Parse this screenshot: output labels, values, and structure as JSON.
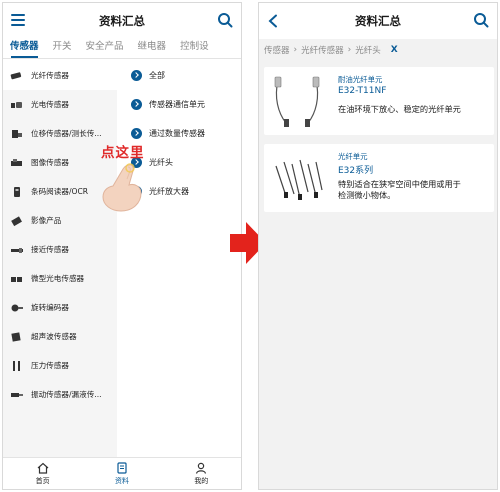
{
  "left_screen": {
    "header": {
      "title": "资料汇总"
    },
    "category_tabs": [
      "传感器",
      "开关",
      "安全产品",
      "继电器",
      "控制设"
    ],
    "sidebar": {
      "items": [
        {
          "label": "光纤传感器",
          "icon": "fiber-sensor-icon"
        },
        {
          "label": "光电传感器",
          "icon": "photoelectric-sensor-icon"
        },
        {
          "label": "位移传感器/测长传...",
          "icon": "displacement-sensor-icon"
        },
        {
          "label": "图像传感器",
          "icon": "image-sensor-icon"
        },
        {
          "label": "条码阅读器/OCR",
          "icon": "barcode-reader-icon"
        },
        {
          "label": "影像产品",
          "icon": "camera-product-icon"
        },
        {
          "label": "接近传感器",
          "icon": "proximity-sensor-icon"
        },
        {
          "label": "微型光电传感器",
          "icon": "micro-sensor-icon"
        },
        {
          "label": "旋转编码器",
          "icon": "rotary-encoder-icon"
        },
        {
          "label": "超声波传感器",
          "icon": "ultrasonic-sensor-icon"
        },
        {
          "label": "压力传感器",
          "icon": "pressure-sensor-icon"
        },
        {
          "label": "振动传感器/漏液传...",
          "icon": "vibration-sensor-icon"
        }
      ],
      "active_index": 0
    },
    "subcategories": [
      "全部",
      "传感器通信单元",
      "通过数量传感器",
      "光纤头",
      "光纤放大器"
    ],
    "annotation": "点这里",
    "bottom_nav": [
      {
        "label": "首页",
        "icon": "home-icon"
      },
      {
        "label": "资料",
        "icon": "document-icon"
      },
      {
        "label": "我的",
        "icon": "user-icon"
      }
    ],
    "bottom_nav_active": 1
  },
  "right_screen": {
    "header": {
      "title": "资料汇总"
    },
    "breadcrumb": [
      "传感器",
      "光纤传感器",
      "光纤头"
    ],
    "breadcrumb_close": "X",
    "products": [
      {
        "category": "耐油光纤单元",
        "model": "E32-T11NF",
        "description": "在油环境下放心、稳定的光纤单元"
      },
      {
        "category": "光纤单元",
        "model": "E32系列",
        "description_line1": "特别适合在狭窄空间中使用或用于",
        "description_line2": "检测微小物体。"
      }
    ]
  },
  "colors": {
    "accent": "#0a5b96",
    "annotation": "#e02a2a",
    "arrow": "#e3231c",
    "sidebar_bg": "#f5f5f5",
    "list_bg": "#f2f2f2"
  }
}
